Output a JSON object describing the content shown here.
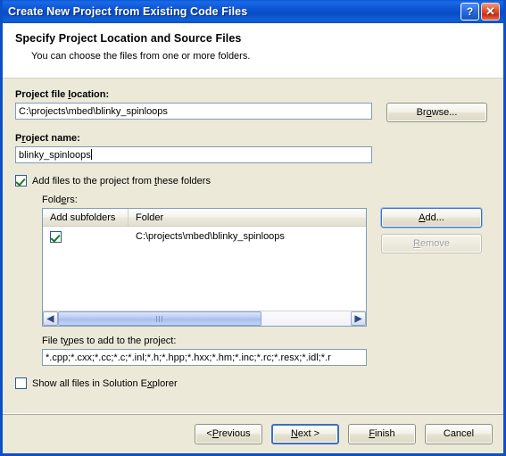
{
  "window": {
    "title": "Create New Project from Existing Code Files",
    "help_button": "?",
    "close_button": "✕"
  },
  "header": {
    "title": "Specify Project Location and Source Files",
    "subtitle": "You can choose the files from one or more folders."
  },
  "project_location": {
    "label_before": "Project file ",
    "label_accel": "l",
    "label_after": "ocation:",
    "value": "C:\\projects\\mbed\\blinky_spinloops",
    "browse_button_before": "Br",
    "browse_button_accel": "o",
    "browse_button_after": "wse..."
  },
  "project_name": {
    "label_before": "P",
    "label_accel": "r",
    "label_after": "oject name:",
    "value": "blinky_spinloops"
  },
  "add_files_checkbox": {
    "label_before": "Add files to the project from ",
    "label_accel": "t",
    "label_after": "hese folders",
    "checked": true
  },
  "folders": {
    "label_before": "Fold",
    "label_accel": "e",
    "label_after": "rs:",
    "columns": [
      "Add subfolders",
      "Folder"
    ],
    "rows": [
      {
        "add_subfolders": true,
        "folder": "C:\\projects\\mbed\\blinky_spinloops"
      }
    ],
    "add_button_before": "",
    "add_button_accel": "A",
    "add_button_after": "dd...",
    "remove_button_before": "",
    "remove_button_accel": "R",
    "remove_button_after": "emove",
    "remove_disabled": true
  },
  "file_types": {
    "label_before": "File t",
    "label_accel": "y",
    "label_after": "pes to add to the project:",
    "value": "*.cpp;*.cxx;*.cc;*.c;*.inl;*.h;*.hpp;*.hxx;*.hm;*.inc;*.rc;*.resx;*.idl;*.r"
  },
  "show_all_files": {
    "label_before": "Show all files in Solution E",
    "label_accel": "x",
    "label_after": "plorer",
    "checked": false
  },
  "footer": {
    "previous_before": "< ",
    "previous_accel": "P",
    "previous_after": "revious",
    "next_before": "",
    "next_accel": "N",
    "next_after": "ext >",
    "finish_before": "",
    "finish_accel": "F",
    "finish_after": "inish",
    "cancel": "Cancel"
  },
  "colors": {
    "dialog_background": "#ece9d8",
    "titlebar_blue": "#0c50c8",
    "input_border": "#7f9db9",
    "check_green": "#1a7a1a",
    "close_red": "#c8301a"
  }
}
